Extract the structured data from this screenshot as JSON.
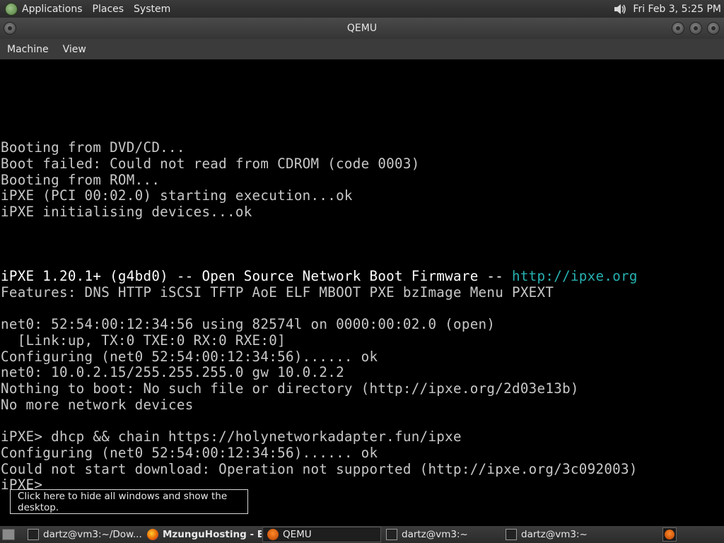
{
  "top_panel": {
    "menus": [
      "Applications",
      "Places",
      "System"
    ],
    "clock": "Fri Feb  3, 5:25 PM"
  },
  "window": {
    "title": "QEMU",
    "menus": [
      "Machine",
      "View"
    ]
  },
  "console": {
    "lines": [
      "Booting from DVD/CD...",
      "Boot failed: Could not read from CDROM (code 0003)",
      "Booting from ROM...",
      "iPXE (PCI 00:02.0) starting execution...ok",
      "iPXE initialising devices...ok",
      "",
      "",
      "",
      "iPXE 1.20.1+ (g4bd0) -- Open Source Network Boot Firmware -- ",
      "Features: DNS HTTP iSCSI TFTP AoE ELF MBOOT PXE bzImage Menu PXEXT",
      "",
      "net0: 52:54:00:12:34:56 using 82574l on 0000:00:02.0 (open)",
      "  [Link:up, TX:0 TXE:0 RX:0 RXE:0]",
      "Configuring (net0 52:54:00:12:34:56)...... ok",
      "net0: 10.0.2.15/255.255.255.0 gw 10.0.2.2",
      "Nothing to boot: No such file or directory (http://ipxe.org/2d03e13b)",
      "No more network devices",
      "",
      "iPXE> dhcp && chain https://holynetworkadapter.fun/ipxe",
      "Configuring (net0 52:54:00:12:34:56)...... ok",
      "Could not start download: Operation not supported (http://ipxe.org/3c092003)",
      "iPXE>"
    ],
    "banner_link": "http://ipxe.org"
  },
  "tooltip": "Click here to hide all windows and show the desktop.",
  "taskbar": {
    "tasks": [
      {
        "label": "dartz@vm3:~/Dow...",
        "icon": "terminal-icon"
      },
      {
        "label": "MzunguHosting - B...",
        "icon": "firefox-icon"
      },
      {
        "label": "QEMU",
        "icon": "qemu-icon"
      },
      {
        "label": "dartz@vm3:~",
        "icon": "terminal-icon"
      },
      {
        "label": "dartz@vm3:~",
        "icon": "terminal-icon"
      }
    ]
  },
  "colors": {
    "console_text": "#c8c8c8",
    "console_bright": "#ffffff",
    "link": "#27b0b0",
    "panel_bg": "#3b3b3b"
  }
}
